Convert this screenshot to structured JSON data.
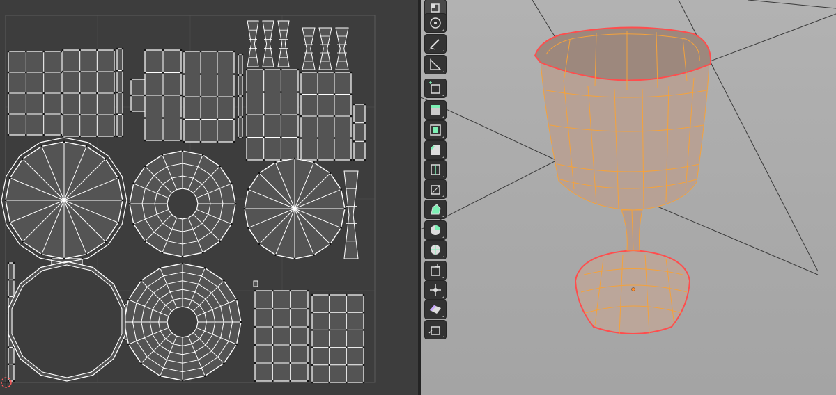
{
  "uv_editor": {
    "background": "#3d3d3d",
    "island_fill": "#545454",
    "edge_color": "#ffffff",
    "grid_color": "#464646"
  },
  "viewport": {
    "background": "#ababab",
    "object_fill": "#b69f93",
    "wire_color": "#f4a23c",
    "selection_outline": "#ff4d4d",
    "object": "goblet-mesh"
  },
  "toolbar": {
    "tools": [
      {
        "icon": "select-box-icon"
      },
      {
        "icon": "cursor-icon"
      },
      {
        "icon": "annotate-icon"
      },
      {
        "icon": "measure-icon"
      },
      {
        "icon": "add-cube-icon"
      },
      {
        "icon": "extrude-region-icon"
      },
      {
        "icon": "inset-faces-icon"
      },
      {
        "icon": "bevel-icon"
      },
      {
        "icon": "loop-cut-icon"
      },
      {
        "icon": "knife-icon"
      },
      {
        "icon": "poly-build-icon"
      },
      {
        "icon": "spin-icon"
      },
      {
        "icon": "smooth-icon"
      },
      {
        "icon": "edge-slide-icon"
      },
      {
        "icon": "shrink-fatten-icon"
      },
      {
        "icon": "shear-icon"
      },
      {
        "icon": "rip-region-icon"
      }
    ]
  }
}
